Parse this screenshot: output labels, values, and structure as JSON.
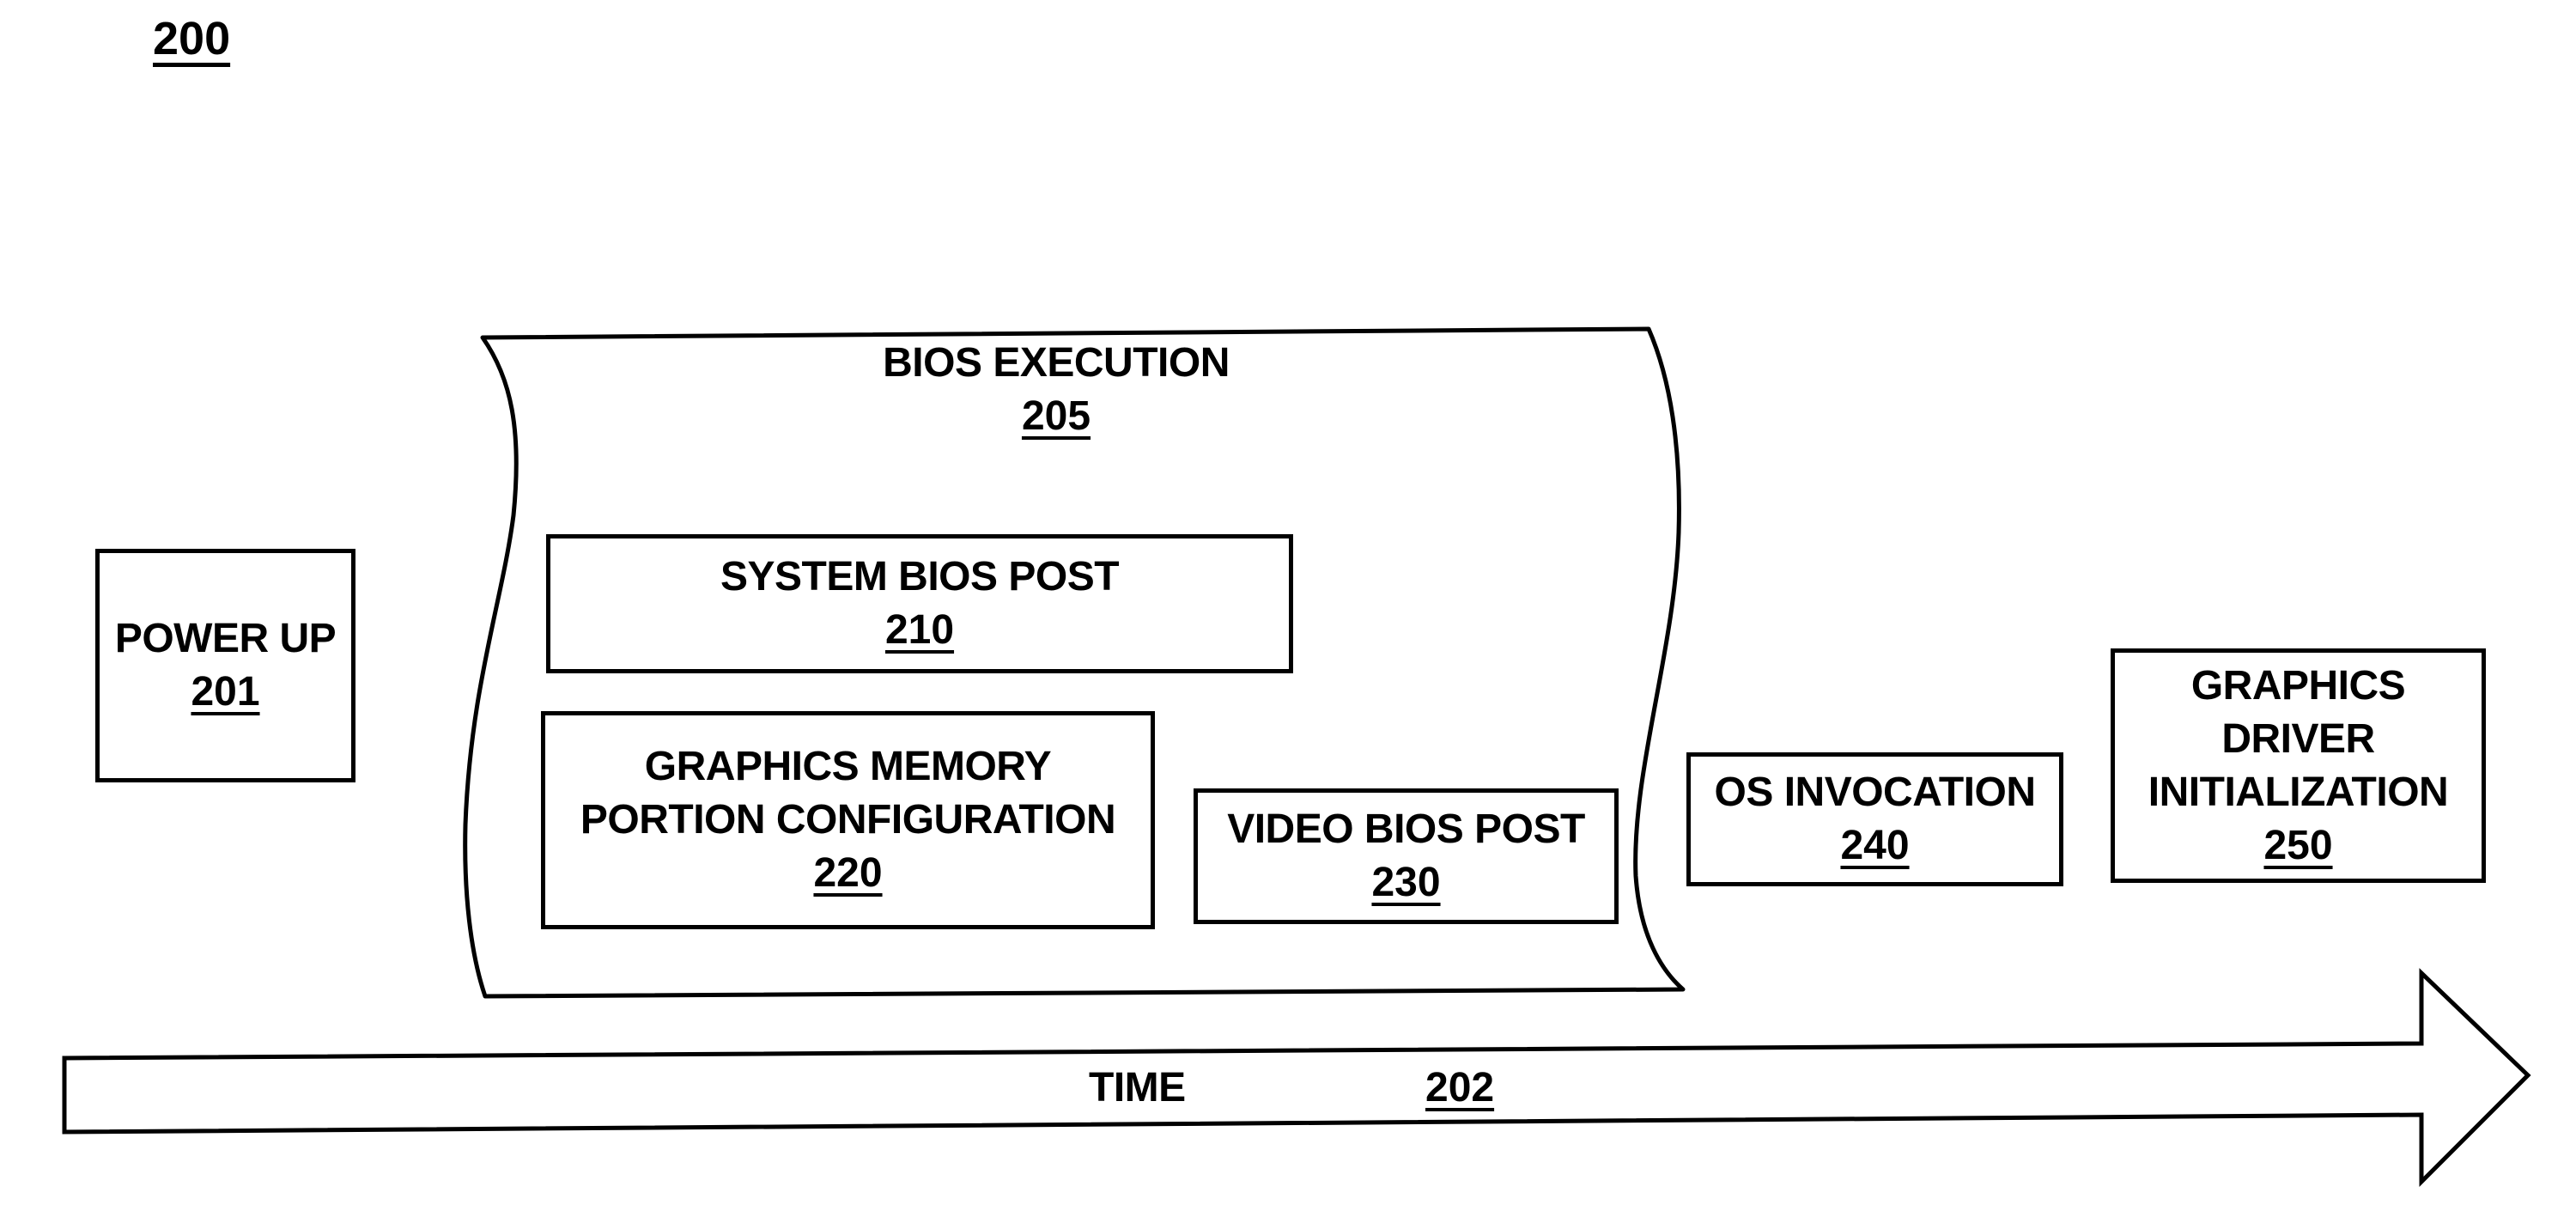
{
  "figure": {
    "number": "200"
  },
  "nodes": {
    "power_up": {
      "lines": [
        "POWER UP"
      ],
      "ref": "201"
    },
    "bios_execution": {
      "lines": [
        "BIOS EXECUTION"
      ],
      "ref": "205"
    },
    "system_bios_post": {
      "lines": [
        "SYSTEM BIOS POST"
      ],
      "ref": "210"
    },
    "graphics_memory": {
      "lines": [
        "GRAPHICS MEMORY",
        "PORTION CONFIGURATION"
      ],
      "ref": "220"
    },
    "video_bios_post": {
      "lines": [
        "VIDEO BIOS POST"
      ],
      "ref": "230"
    },
    "os_invocation": {
      "lines": [
        "OS INVOCATION"
      ],
      "ref": "240"
    },
    "graphics_driver": {
      "lines": [
        "GRAPHICS",
        "DRIVER",
        "INITIALIZATION"
      ],
      "ref": "250"
    }
  },
  "timeline": {
    "label": "TIME",
    "ref": "202"
  }
}
